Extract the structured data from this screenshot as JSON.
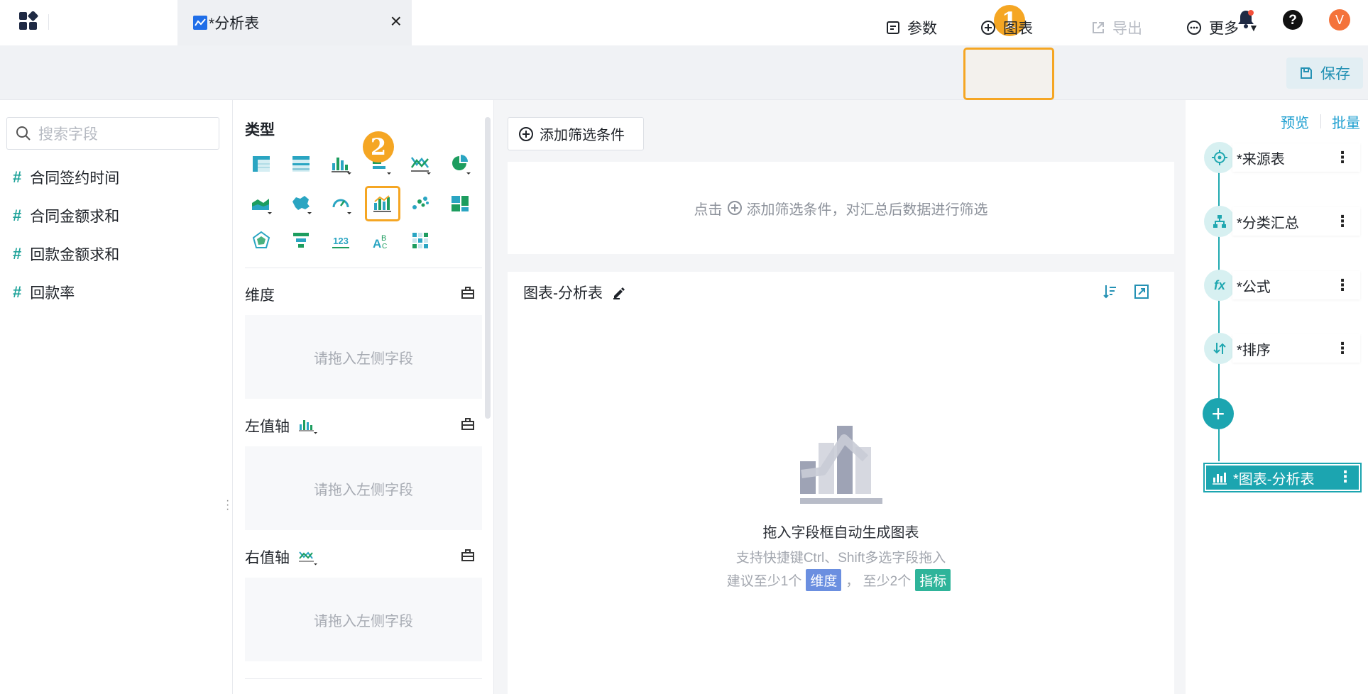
{
  "tab": {
    "title": "*分析表"
  },
  "markers": {
    "one": "1",
    "two": "2"
  },
  "user": {
    "avatar_letter": "V"
  },
  "toolbar": {
    "params_label": "参数",
    "chart_label": "图表",
    "export_label": "导出",
    "more_label": "更多",
    "save_label": "保存"
  },
  "fields": {
    "search_placeholder": "搜索字段",
    "items": [
      "合同签约时间",
      "合同金额求和",
      "回款金额求和",
      "回款率"
    ]
  },
  "config": {
    "type_title": "类型",
    "dimension_title": "维度",
    "left_axis_title": "左值轴",
    "right_axis_title": "右值轴",
    "drop_hint": "请拖入左侧字段"
  },
  "filter": {
    "add_label": "添加筛选条件",
    "hint_prefix": "点击",
    "hint_suffix": "添加筛选条件，对汇总后数据进行筛选"
  },
  "chart": {
    "title": "图表-分析表",
    "empty_main": "拖入字段框自动生成图表",
    "empty_sub": "支持快捷键Ctrl、Shift多选字段拖入",
    "suggest_a": "建议至少1个",
    "dim_tag": "维度",
    "suggest_b": "，  至少2个",
    "metric_tag": "指标"
  },
  "steps": {
    "preview_label": "预览",
    "batch_label": "批量",
    "items": [
      "*来源表",
      "*分类汇总",
      "*公式",
      "*排序"
    ],
    "formula_icon_text": "fx",
    "active": "*图表-分析表"
  },
  "colors": {
    "accent": "#1ca5b0",
    "highlight": "#f5a623",
    "link": "#1d9fd0"
  }
}
